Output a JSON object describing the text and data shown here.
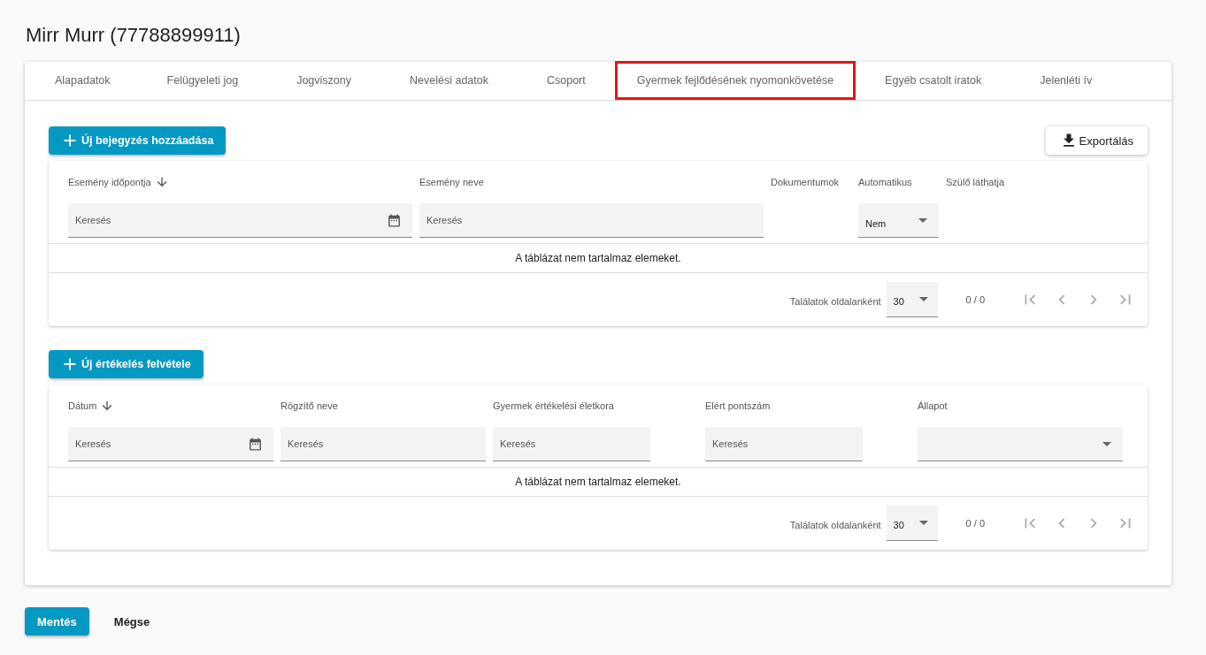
{
  "title": "Mirr Murr (77788899911)",
  "tabs": [
    {
      "label": "Alapadatok",
      "selected": false
    },
    {
      "label": "Felügyeleti jog",
      "selected": false
    },
    {
      "label": "Jogviszony",
      "selected": false
    },
    {
      "label": "Nevelési adatok",
      "selected": false
    },
    {
      "label": "Csoport",
      "selected": false
    },
    {
      "label": "Gyermek fejlődésének nyomonkövetése",
      "selected": true
    },
    {
      "label": "Egyéb csatolt iratok",
      "selected": false
    },
    {
      "label": "Jelenléti ív",
      "selected": false
    }
  ],
  "sections": [
    {
      "add_button": "Új bejegyzés hozzáadása",
      "export_button": "Exportálás",
      "columns": [
        {
          "label": "Esemény időpontja",
          "sorted": true,
          "filter": {
            "kind": "date",
            "placeholder": "Keresés"
          }
        },
        {
          "label": "Esemény neve",
          "sorted": false,
          "filter": {
            "kind": "text",
            "placeholder": "Keresés"
          }
        },
        {
          "label": "Dokumentumok",
          "sorted": false
        },
        {
          "label": "Automatikus",
          "sorted": false,
          "filter": {
            "kind": "select",
            "value": "Nem"
          }
        },
        {
          "label": "Szülő láthatja",
          "sorted": false
        }
      ],
      "empty_text": "A táblázat nem tartalmaz elemeket.",
      "paginator": {
        "label": "Találatok oldalanként",
        "page_size": "30",
        "range": "0 / 0"
      }
    },
    {
      "add_button": "Új értékelés felvétele",
      "columns": [
        {
          "label": "Dátum",
          "sorted": true,
          "filter": {
            "kind": "date",
            "placeholder": "Keresés"
          }
        },
        {
          "label": "Rögzítő neve",
          "sorted": false,
          "filter": {
            "kind": "text",
            "placeholder": "Keresés"
          }
        },
        {
          "label": "Gyermek értékelési életkora",
          "sorted": false,
          "filter": {
            "kind": "text",
            "placeholder": "Keresés"
          }
        },
        {
          "label": "Elért pontszám",
          "sorted": false,
          "filter": {
            "kind": "text",
            "placeholder": "Keresés"
          }
        },
        {
          "label": "Állapot",
          "sorted": false,
          "filter": {
            "kind": "select"
          }
        }
      ],
      "empty_text": "A táblázat nem tartalmaz elemeket.",
      "paginator": {
        "label": "Találatok oldalanként",
        "page_size": "30",
        "range": "0 / 0"
      }
    }
  ],
  "footer": {
    "save": "Mentés",
    "cancel": "Mégse"
  }
}
